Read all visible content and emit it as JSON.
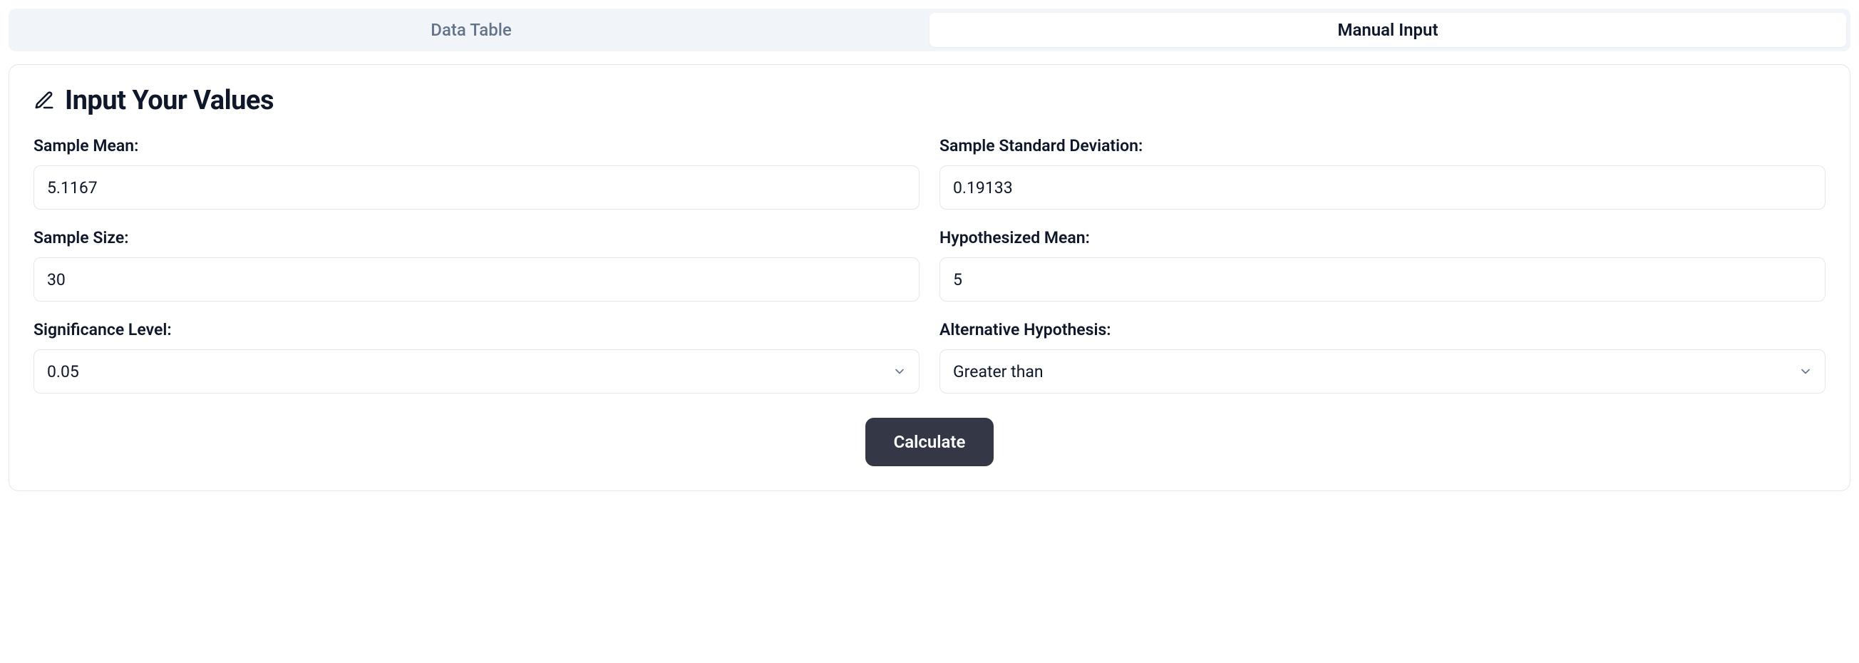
{
  "tabs": {
    "data_table": "Data Table",
    "manual_input": "Manual Input"
  },
  "card": {
    "title": "Input Your Values"
  },
  "form": {
    "sample_mean": {
      "label": "Sample Mean:",
      "value": "5.1167"
    },
    "sample_std": {
      "label": "Sample Standard Deviation:",
      "value": "0.19133"
    },
    "sample_size": {
      "label": "Sample Size:",
      "value": "30"
    },
    "hyp_mean": {
      "label": "Hypothesized Mean:",
      "value": "5"
    },
    "sig_level": {
      "label": "Significance Level:",
      "value": "0.05"
    },
    "alt_hyp": {
      "label": "Alternative Hypothesis:",
      "value": "Greater than"
    }
  },
  "actions": {
    "calculate": "Calculate"
  }
}
